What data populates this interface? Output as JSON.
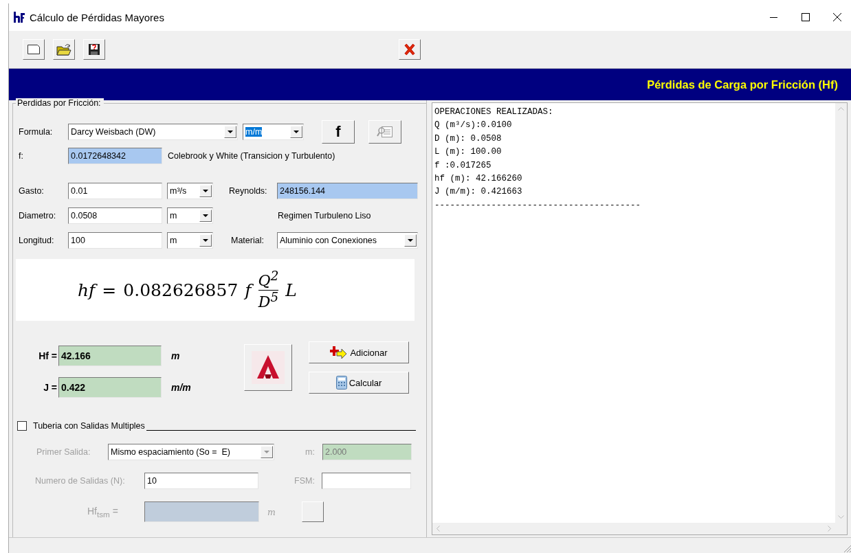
{
  "window": {
    "title": "Cálculo de Pérdidas Mayores"
  },
  "header": {
    "title": "Pérdidas de Carga por Fricción (Hf)"
  },
  "friction": {
    "legend": "Perdidas por Fricción:",
    "formula": {
      "label": "Formula:",
      "value": "Darcy Weisbach (DW)",
      "unit": "m/m",
      "unit_selected": true
    },
    "f_button": {
      "label": "f"
    },
    "report_button": {
      "disabled": true
    },
    "f": {
      "label": "f:",
      "value": "0.0172648342",
      "method": "Colebrook y White (Transicion y Turbulento)"
    },
    "inputs": [
      {
        "label": "Gasto:",
        "value": "0.01",
        "unit": "m³/s"
      },
      {
        "label": "Diametro:",
        "value": "0.0508",
        "unit": "m"
      },
      {
        "label": "Longitud:",
        "value": "100",
        "unit": "m"
      }
    ],
    "reynolds": {
      "label": "Reynolds:",
      "value": "248156.144",
      "regime": "Regimen Turbuleno Liso"
    },
    "material": {
      "label": "Material:",
      "value": "Aluminio con Conexiones"
    },
    "equation": {
      "lhs": "hf",
      "equals": "=",
      "coefficient": "0.082626857",
      "factor": "f",
      "numerator": "Q$^{2}$",
      "denominator": "D$^{5}$",
      "tail": "L"
    },
    "results": [
      {
        "label": "Hf =",
        "value": "42.166",
        "unit": "m"
      },
      {
        "label": "J =",
        "value": "0.422",
        "unit": "m/m"
      }
    ],
    "buttons": [
      {
        "kind": "add",
        "label": "Adicionar"
      },
      {
        "kind": "calculate",
        "label": "Calcular"
      }
    ]
  },
  "multiple_outlets": {
    "label": "Tuberia con Salidas Multiples",
    "checked": false,
    "disabled": true,
    "first_outlet": {
      "label": "Primer Salida:",
      "value": "Mismo espaciamiento (So =  E)"
    },
    "m": {
      "label": "m:",
      "value": "2.000"
    },
    "outlets": {
      "label": "Numero de Salidas (N):",
      "value": "10"
    },
    "fsm": {
      "label": "FSM:"
    },
    "hf_tsm": {
      "label": "Hf$_{tsm}$ =",
      "unit": "m"
    }
  },
  "log": {
    "lines": [
      "OPERACIONES REALIZADAS:",
      "Q (m³/s):0.0100",
      "D (m): 0.0508",
      "L (m): 100.00",
      "f :0.017265",
      "hf (m): 42.166260",
      "J (m/m): 0.421663",
      "----------------------------------------"
    ]
  }
}
